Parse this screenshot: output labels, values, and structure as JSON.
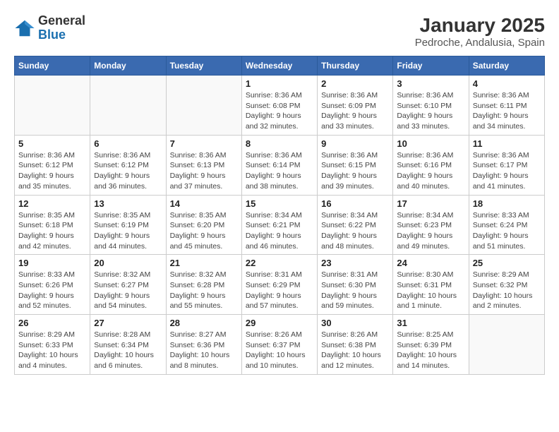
{
  "logo": {
    "general": "General",
    "blue": "Blue"
  },
  "title": "January 2025",
  "location": "Pedroche, Andalusia, Spain",
  "days_of_week": [
    "Sunday",
    "Monday",
    "Tuesday",
    "Wednesday",
    "Thursday",
    "Friday",
    "Saturday"
  ],
  "weeks": [
    [
      {
        "day": "",
        "info": ""
      },
      {
        "day": "",
        "info": ""
      },
      {
        "day": "",
        "info": ""
      },
      {
        "day": "1",
        "info": "Sunrise: 8:36 AM\nSunset: 6:08 PM\nDaylight: 9 hours\nand 32 minutes."
      },
      {
        "day": "2",
        "info": "Sunrise: 8:36 AM\nSunset: 6:09 PM\nDaylight: 9 hours\nand 33 minutes."
      },
      {
        "day": "3",
        "info": "Sunrise: 8:36 AM\nSunset: 6:10 PM\nDaylight: 9 hours\nand 33 minutes."
      },
      {
        "day": "4",
        "info": "Sunrise: 8:36 AM\nSunset: 6:11 PM\nDaylight: 9 hours\nand 34 minutes."
      }
    ],
    [
      {
        "day": "5",
        "info": "Sunrise: 8:36 AM\nSunset: 6:12 PM\nDaylight: 9 hours\nand 35 minutes."
      },
      {
        "day": "6",
        "info": "Sunrise: 8:36 AM\nSunset: 6:12 PM\nDaylight: 9 hours\nand 36 minutes."
      },
      {
        "day": "7",
        "info": "Sunrise: 8:36 AM\nSunset: 6:13 PM\nDaylight: 9 hours\nand 37 minutes."
      },
      {
        "day": "8",
        "info": "Sunrise: 8:36 AM\nSunset: 6:14 PM\nDaylight: 9 hours\nand 38 minutes."
      },
      {
        "day": "9",
        "info": "Sunrise: 8:36 AM\nSunset: 6:15 PM\nDaylight: 9 hours\nand 39 minutes."
      },
      {
        "day": "10",
        "info": "Sunrise: 8:36 AM\nSunset: 6:16 PM\nDaylight: 9 hours\nand 40 minutes."
      },
      {
        "day": "11",
        "info": "Sunrise: 8:36 AM\nSunset: 6:17 PM\nDaylight: 9 hours\nand 41 minutes."
      }
    ],
    [
      {
        "day": "12",
        "info": "Sunrise: 8:35 AM\nSunset: 6:18 PM\nDaylight: 9 hours\nand 42 minutes."
      },
      {
        "day": "13",
        "info": "Sunrise: 8:35 AM\nSunset: 6:19 PM\nDaylight: 9 hours\nand 44 minutes."
      },
      {
        "day": "14",
        "info": "Sunrise: 8:35 AM\nSunset: 6:20 PM\nDaylight: 9 hours\nand 45 minutes."
      },
      {
        "day": "15",
        "info": "Sunrise: 8:34 AM\nSunset: 6:21 PM\nDaylight: 9 hours\nand 46 minutes."
      },
      {
        "day": "16",
        "info": "Sunrise: 8:34 AM\nSunset: 6:22 PM\nDaylight: 9 hours\nand 48 minutes."
      },
      {
        "day": "17",
        "info": "Sunrise: 8:34 AM\nSunset: 6:23 PM\nDaylight: 9 hours\nand 49 minutes."
      },
      {
        "day": "18",
        "info": "Sunrise: 8:33 AM\nSunset: 6:24 PM\nDaylight: 9 hours\nand 51 minutes."
      }
    ],
    [
      {
        "day": "19",
        "info": "Sunrise: 8:33 AM\nSunset: 6:26 PM\nDaylight: 9 hours\nand 52 minutes."
      },
      {
        "day": "20",
        "info": "Sunrise: 8:32 AM\nSunset: 6:27 PM\nDaylight: 9 hours\nand 54 minutes."
      },
      {
        "day": "21",
        "info": "Sunrise: 8:32 AM\nSunset: 6:28 PM\nDaylight: 9 hours\nand 55 minutes."
      },
      {
        "day": "22",
        "info": "Sunrise: 8:31 AM\nSunset: 6:29 PM\nDaylight: 9 hours\nand 57 minutes."
      },
      {
        "day": "23",
        "info": "Sunrise: 8:31 AM\nSunset: 6:30 PM\nDaylight: 9 hours\nand 59 minutes."
      },
      {
        "day": "24",
        "info": "Sunrise: 8:30 AM\nSunset: 6:31 PM\nDaylight: 10 hours\nand 1 minute."
      },
      {
        "day": "25",
        "info": "Sunrise: 8:29 AM\nSunset: 6:32 PM\nDaylight: 10 hours\nand 2 minutes."
      }
    ],
    [
      {
        "day": "26",
        "info": "Sunrise: 8:29 AM\nSunset: 6:33 PM\nDaylight: 10 hours\nand 4 minutes."
      },
      {
        "day": "27",
        "info": "Sunrise: 8:28 AM\nSunset: 6:34 PM\nDaylight: 10 hours\nand 6 minutes."
      },
      {
        "day": "28",
        "info": "Sunrise: 8:27 AM\nSunset: 6:36 PM\nDaylight: 10 hours\nand 8 minutes."
      },
      {
        "day": "29",
        "info": "Sunrise: 8:26 AM\nSunset: 6:37 PM\nDaylight: 10 hours\nand 10 minutes."
      },
      {
        "day": "30",
        "info": "Sunrise: 8:26 AM\nSunset: 6:38 PM\nDaylight: 10 hours\nand 12 minutes."
      },
      {
        "day": "31",
        "info": "Sunrise: 8:25 AM\nSunset: 6:39 PM\nDaylight: 10 hours\nand 14 minutes."
      },
      {
        "day": "",
        "info": ""
      }
    ]
  ]
}
